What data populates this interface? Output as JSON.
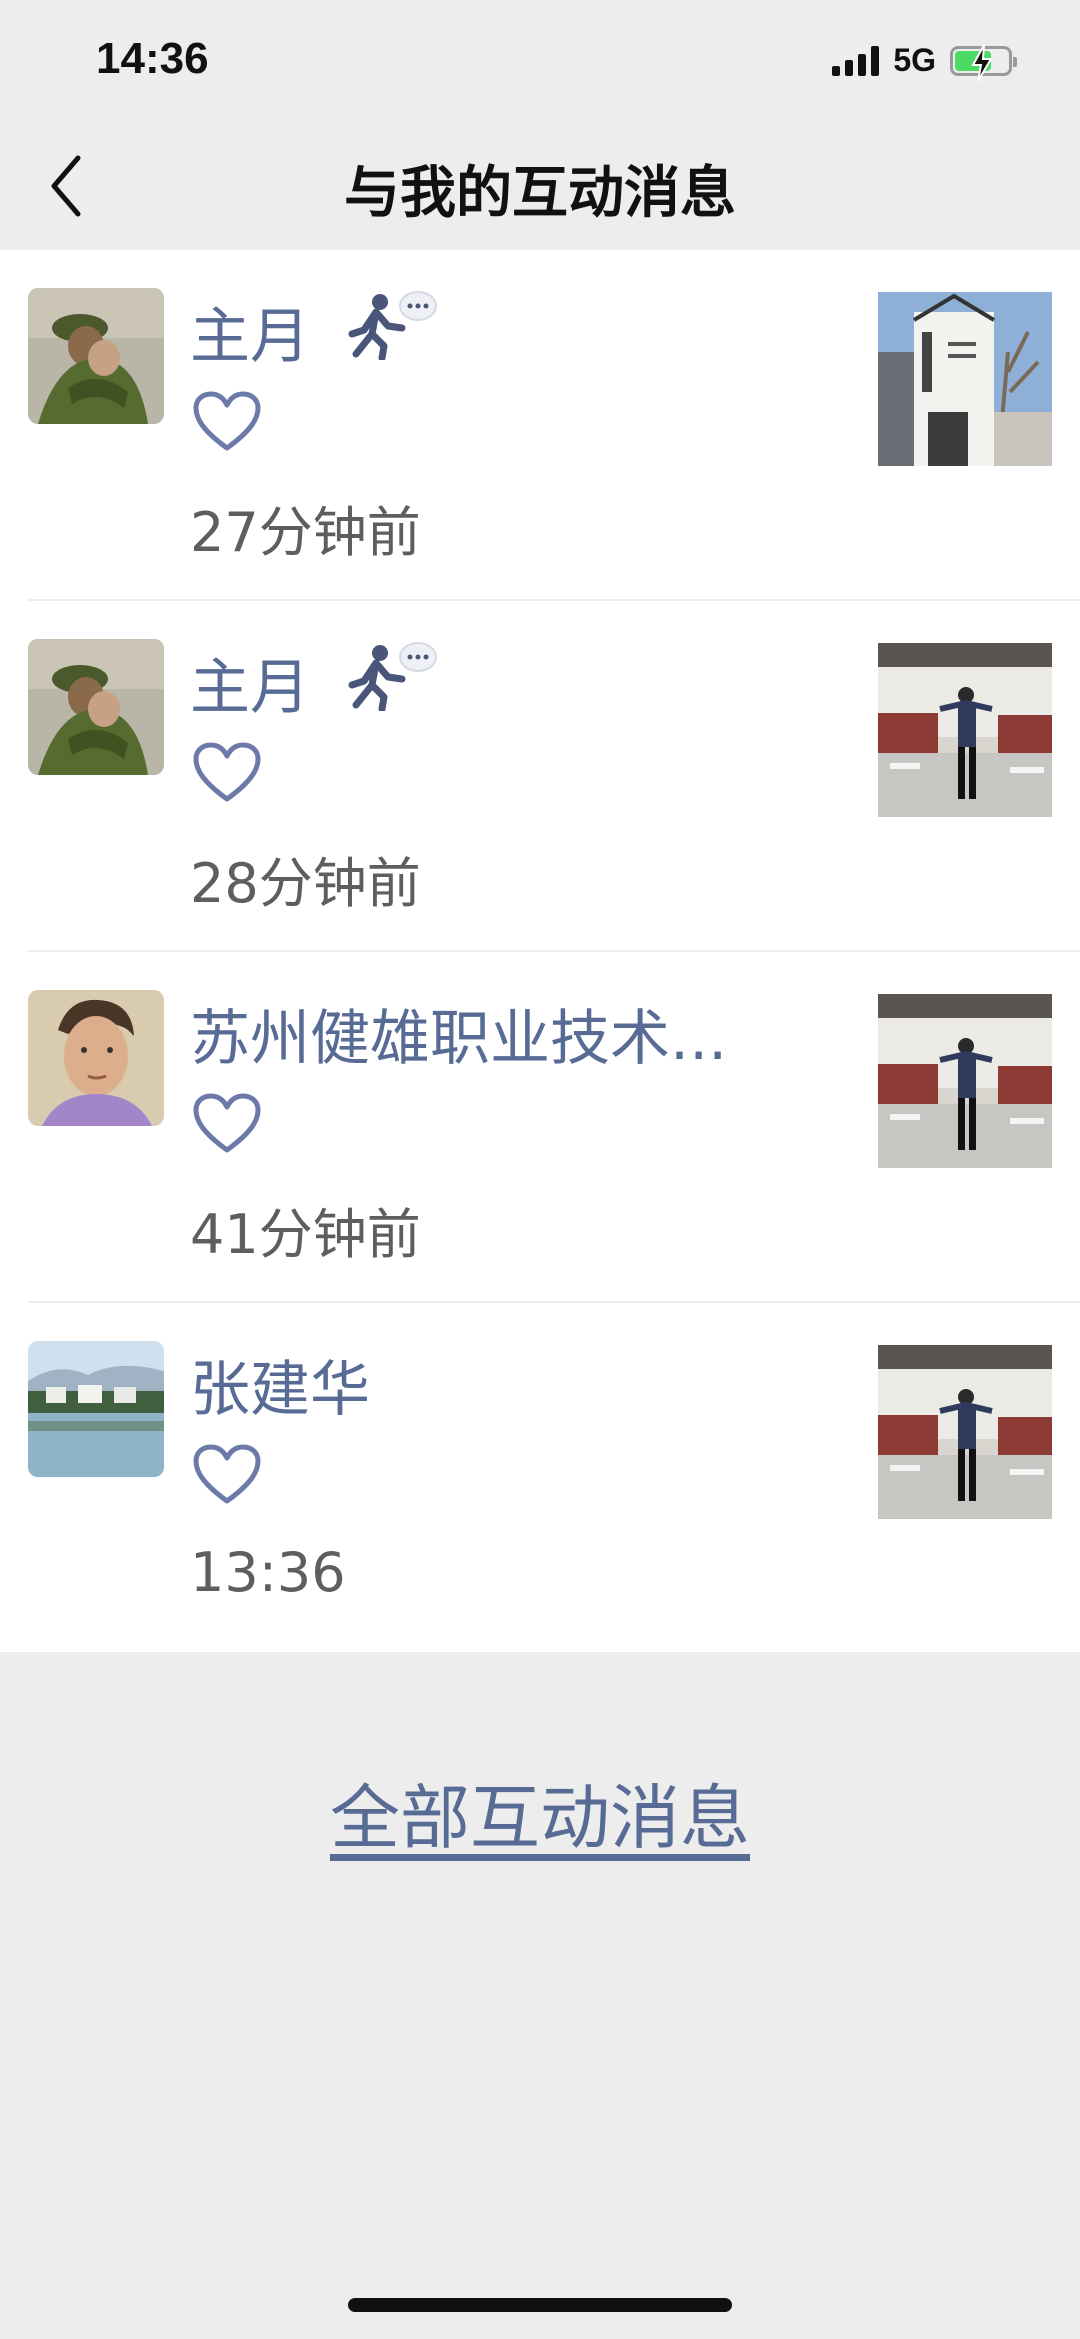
{
  "status_bar": {
    "time": "14:36",
    "network": "5G",
    "battery_level": 0.7
  },
  "nav": {
    "title": "与我的互动消息",
    "back_icon": "chevron-left-icon"
  },
  "items": [
    {
      "name": "主月",
      "status_icon": "running-status-icon",
      "reaction_icon": "heart-outline-icon",
      "time": "27分钟前",
      "avatar": "soldier-embrace-photo",
      "thumbnail": "building-exterior-photo"
    },
    {
      "name": "主月",
      "status_icon": "running-status-icon",
      "reaction_icon": "heart-outline-icon",
      "time": "28分钟前",
      "avatar": "soldier-embrace-photo",
      "thumbnail": "man-in-hall-photo"
    },
    {
      "name": "苏州健雄职业技术...",
      "status_icon": "",
      "reaction_icon": "heart-outline-icon",
      "time": "41分钟前",
      "avatar": "portrait-painting-photo",
      "thumbnail": "man-in-hall-photo"
    },
    {
      "name": "张建华",
      "status_icon": "",
      "reaction_icon": "heart-outline-icon",
      "time": "13:36",
      "avatar": "lake-village-photo",
      "thumbnail": "man-in-hall-photo"
    }
  ],
  "footer": {
    "all_messages_label": "全部互动消息"
  },
  "colors": {
    "link": "#576b95",
    "background": "#ededed",
    "heart": "#6b7aa8"
  }
}
